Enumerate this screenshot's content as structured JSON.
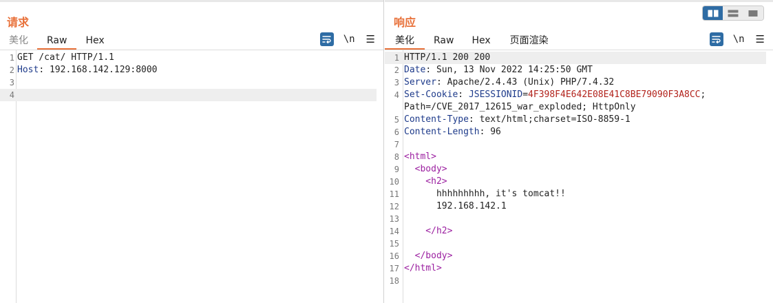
{
  "request": {
    "title": "请求",
    "tabs": [
      {
        "label": "美化",
        "active": false
      },
      {
        "label": "Raw",
        "active": true
      },
      {
        "label": "Hex",
        "active": false
      }
    ],
    "newline_label": "\\n",
    "menu_glyph": "☰",
    "lines": [
      {
        "n": "1",
        "parts": [
          {
            "c": "v",
            "t": "GET /cat/ HTTP/1.1"
          }
        ]
      },
      {
        "n": "2",
        "parts": [
          {
            "c": "k",
            "t": "Host"
          },
          {
            "c": "v",
            "t": ": 192.168.142.129:8000"
          }
        ]
      },
      {
        "n": "3",
        "parts": []
      },
      {
        "n": "4",
        "parts": [],
        "hl": true
      }
    ]
  },
  "response": {
    "title": "响应",
    "tabs": [
      {
        "label": "美化",
        "active": true
      },
      {
        "label": "Raw",
        "active": false
      },
      {
        "label": "Hex",
        "active": false
      },
      {
        "label": "页面渲染",
        "active": false
      }
    ],
    "newline_label": "\\n",
    "menu_glyph": "☰",
    "lines": [
      {
        "n": "1",
        "parts": [
          {
            "c": "v",
            "t": "HTTP/1.1 200 200"
          }
        ],
        "hl": true
      },
      {
        "n": "2",
        "parts": [
          {
            "c": "k",
            "t": "Date"
          },
          {
            "c": "v",
            "t": ": Sun, 13 Nov 2022 14:25:50 GMT"
          }
        ]
      },
      {
        "n": "3",
        "parts": [
          {
            "c": "k",
            "t": "Server"
          },
          {
            "c": "v",
            "t": ": Apache/2.4.43 (Unix) PHP/7.4.32"
          }
        ]
      },
      {
        "n": "4",
        "parts": [
          {
            "c": "k",
            "t": "Set-Cookie"
          },
          {
            "c": "v",
            "t": ": "
          },
          {
            "c": "ck",
            "t": "JSESSIONID"
          },
          {
            "c": "v",
            "t": "="
          },
          {
            "c": "cv",
            "t": "4F398F4E642E08E41C8BE79090F3A8CC"
          },
          {
            "c": "v",
            "t": ";"
          }
        ]
      },
      {
        "n": "",
        "parts": [
          {
            "c": "v",
            "t": "Path=/CVE_2017_12615_war_exploded; HttpOnly"
          }
        ]
      },
      {
        "n": "5",
        "parts": [
          {
            "c": "k",
            "t": "Content-Type"
          },
          {
            "c": "v",
            "t": ": text/html;charset=ISO-8859-1"
          }
        ]
      },
      {
        "n": "6",
        "parts": [
          {
            "c": "k",
            "t": "Content-Length"
          },
          {
            "c": "v",
            "t": ": 96"
          }
        ]
      },
      {
        "n": "7",
        "parts": []
      },
      {
        "n": "8",
        "parts": [
          {
            "c": "tag",
            "t": "<html>"
          }
        ]
      },
      {
        "n": "9",
        "parts": [
          {
            "c": "tag",
            "t": "  <body>"
          }
        ]
      },
      {
        "n": "10",
        "parts": [
          {
            "c": "tag",
            "t": "    <h2>"
          }
        ]
      },
      {
        "n": "11",
        "parts": [
          {
            "c": "v",
            "t": "      hhhhhhhhh, it's tomcat!!"
          }
        ]
      },
      {
        "n": "12",
        "parts": [
          {
            "c": "v",
            "t": "      192.168.142.1"
          }
        ]
      },
      {
        "n": "13",
        "parts": []
      },
      {
        "n": "14",
        "parts": [
          {
            "c": "tag",
            "t": "    </h2>"
          }
        ]
      },
      {
        "n": "15",
        "parts": []
      },
      {
        "n": "16",
        "parts": [
          {
            "c": "tag",
            "t": "  </body>"
          }
        ]
      },
      {
        "n": "17",
        "parts": [
          {
            "c": "tag",
            "t": "</html>"
          }
        ]
      },
      {
        "n": "18",
        "parts": []
      }
    ]
  },
  "view_toggle": {
    "options": [
      "side-by-side-icon",
      "stacked-icon",
      "single-pane-icon"
    ],
    "active_index": 0
  },
  "colors": {
    "accent": "#e8713a",
    "button_blue": "#2e6ca4",
    "header_key": "#1d3a8a",
    "html_tag": "#9b1fa0",
    "cookie_value": "#b2221b"
  }
}
